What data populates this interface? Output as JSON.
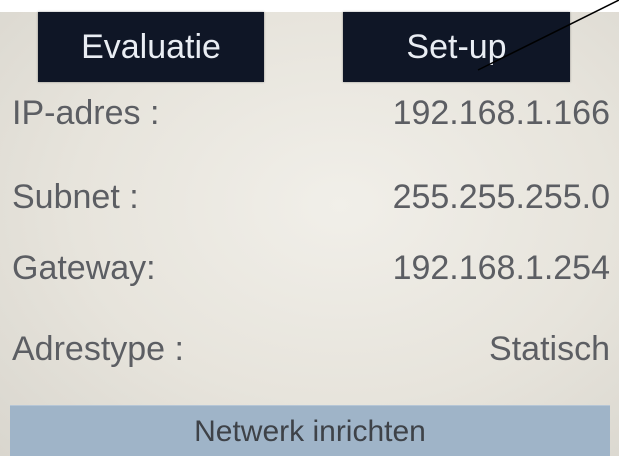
{
  "tabs": {
    "evaluation_label": "Evaluatie",
    "setup_label": "Set-up"
  },
  "network": {
    "ip": {
      "label": "IP-adres :",
      "value": "192.168.1.166"
    },
    "subnet": {
      "label": "Subnet :",
      "value": "255.255.255.0"
    },
    "gateway": {
      "label": "Gateway:",
      "value": "192.168.1.254"
    },
    "address_type": {
      "label": "Adrestype :",
      "value": "Statisch"
    }
  },
  "action": {
    "configure_label": "Netwerk inrichten"
  },
  "colors": {
    "tab_background": "#0f1626",
    "button_background": "#9fb4c8",
    "screen_background": "#e7e4dc"
  }
}
